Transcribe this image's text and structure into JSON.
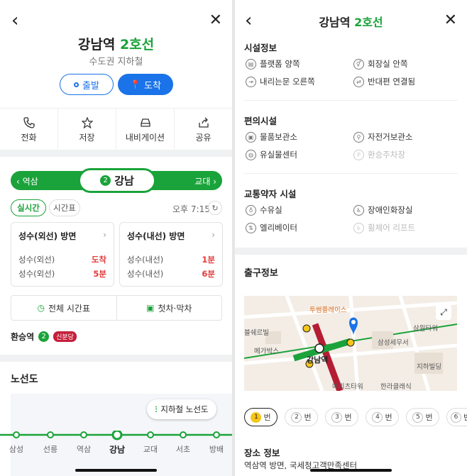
{
  "left": {
    "station_name": "강남역",
    "line_name": "2호선",
    "region": "수도권 지하철",
    "depart_label": "출발",
    "arrive_label": "도착",
    "actions": [
      "전화",
      "저장",
      "내비게이션",
      "공유"
    ],
    "prev_station": "역삼",
    "next_station": "교대",
    "current_station": "강남",
    "line_number": "2",
    "tab_realtime": "실시간",
    "tab_timetable": "시간표",
    "time": "오후 7:15",
    "cards": [
      {
        "direction": "성수(외선) 방면",
        "rows": [
          {
            "dest": "성수(외선)",
            "eta": "도착"
          },
          {
            "dest": "성수(외선)",
            "eta": "5분"
          }
        ]
      },
      {
        "direction": "성수(내선) 방면",
        "rows": [
          {
            "dest": "성수(내선)",
            "eta": "1분"
          },
          {
            "dest": "성수(내선)",
            "eta": "6분"
          }
        ]
      }
    ],
    "full_timetable": "전체 시간표",
    "first_last": "첫차·막차",
    "transfer_label": "환승역",
    "transfer_line": "신분당",
    "route_title": "노선도",
    "route_map_button": "지하철 노선도",
    "route_stations": [
      "삼성",
      "선릉",
      "역삼",
      "강남",
      "교대",
      "서초",
      "방배"
    ]
  },
  "right": {
    "station_name": "강남역",
    "line_name": "2호선",
    "facility_title": "시설정보",
    "facility_items": [
      "플랫폼 양쪽",
      "회장실 안쪽",
      "내리는문 오른쪽",
      "반대편 연결됨"
    ],
    "amenity_title": "편의시설",
    "amenity_items": [
      "물품보관소",
      "자전거보관소",
      "유실물센터",
      "환승주차장"
    ],
    "access_title": "교통약자 시설",
    "access_items": [
      "수유실",
      "장애인화장실",
      "엘리베이터",
      "휠체어 리프트"
    ],
    "exit_title": "출구정보",
    "map_labels": [
      "투썸플레이스",
      "삼원타워",
      "삼성세무서",
      "지하빌딩",
      "한라클래식",
      "메가박스",
      "메리츠타워",
      "강남역",
      "블쉐르빌"
    ],
    "exits": [
      "1",
      "2",
      "3",
      "4",
      "5",
      "6"
    ],
    "exit_suffix": "번",
    "place_title": "장소 정보",
    "place_text": "역삼역 방면, 국세청고객만족센터"
  },
  "colors": {
    "line2": "#1aa33a",
    "blue": "#1a73e8",
    "red": "#e33b3b",
    "shinbundang": "#c51f3a"
  }
}
